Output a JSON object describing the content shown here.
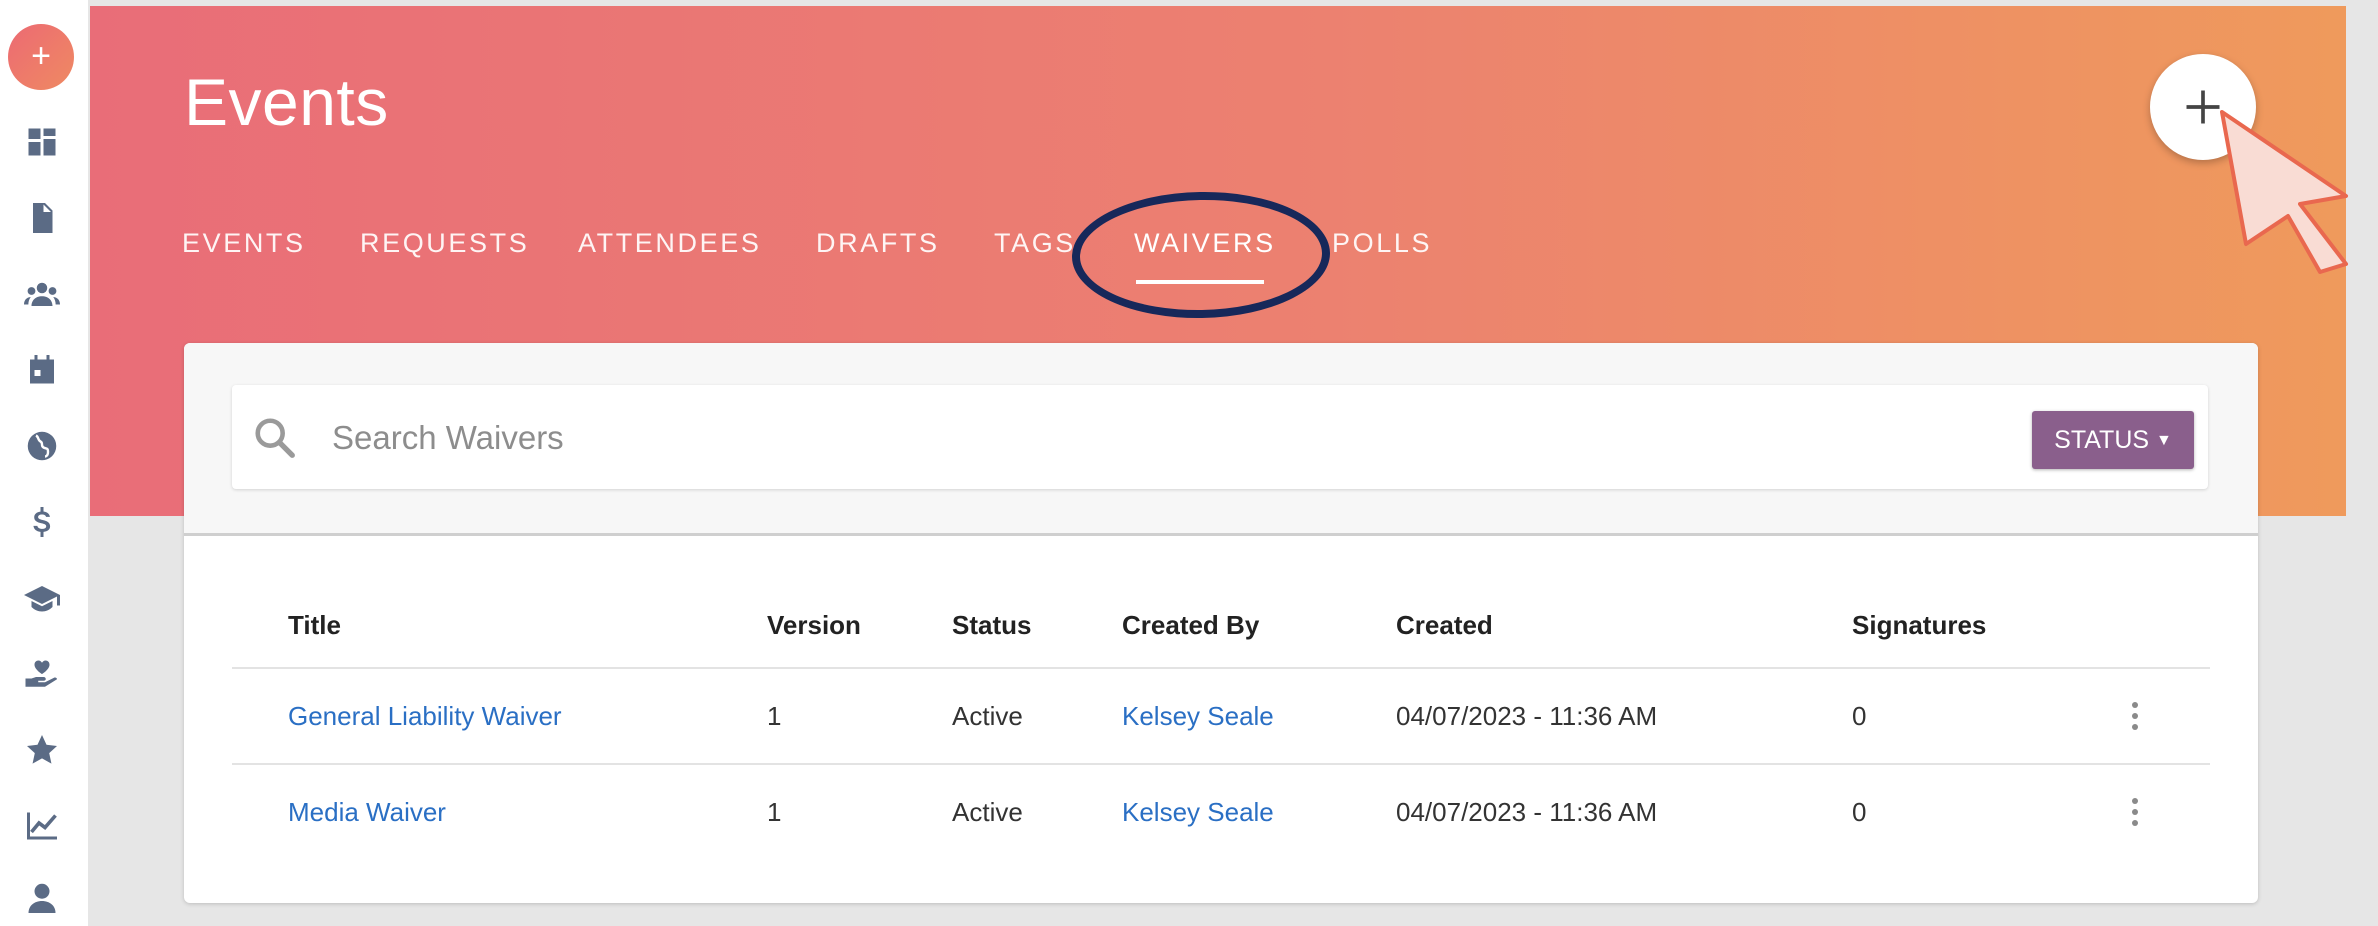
{
  "page": {
    "title": "Events"
  },
  "tabs": [
    "EVENTS",
    "REQUESTS",
    "ATTENDEES",
    "DRAFTS",
    "TAGS",
    "WAIVERS",
    "POLLS"
  ],
  "active_tab": "WAIVERS",
  "sidebar": {
    "fab_icon": "plus-icon",
    "items": [
      "dashboard-icon",
      "document-icon",
      "people-icon",
      "calendar-icon",
      "globe-icon",
      "dollar-icon",
      "graduation-cap-icon",
      "hand-heart-icon",
      "star-icon",
      "chart-icon",
      "user-icon"
    ]
  },
  "add_button_icon": "plus-icon",
  "search": {
    "placeholder": "Search Waivers",
    "value": ""
  },
  "status_button": {
    "label": "STATUS"
  },
  "table": {
    "headers": [
      "Title",
      "Version",
      "Status",
      "Created By",
      "Created",
      "Signatures"
    ],
    "rows": [
      {
        "title": "General Liability Waiver",
        "version": "1",
        "status": "Active",
        "created_by": "Kelsey Seale",
        "created": "04/07/2023 - 11:36 AM",
        "signatures": "0"
      },
      {
        "title": "Media Waiver",
        "version": "1",
        "status": "Active",
        "created_by": "Kelsey Seale",
        "created": "04/07/2023 - 11:36 AM",
        "signatures": "0"
      }
    ]
  },
  "colors": {
    "header_start": "#e96d78",
    "header_end": "#ef9a5c",
    "link": "#2a6fc4",
    "status_button": "#8a5f8c",
    "annotation": "#17285a"
  }
}
